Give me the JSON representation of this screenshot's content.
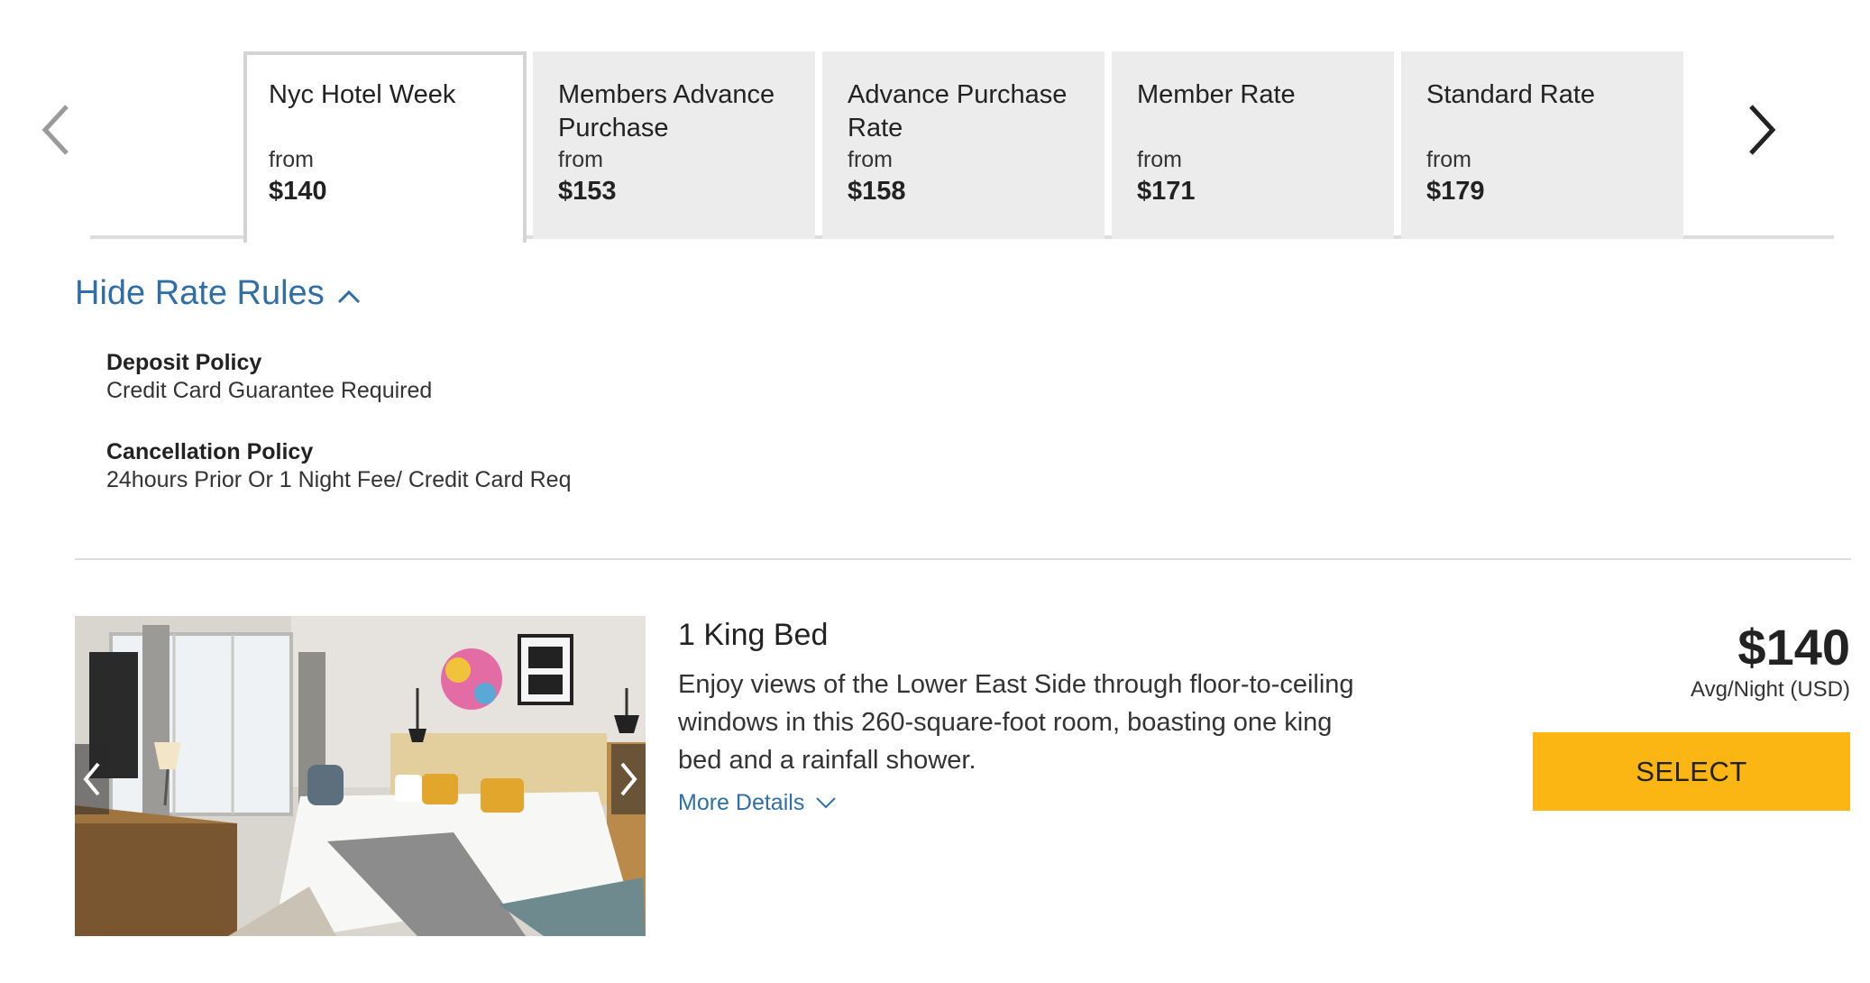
{
  "tabs": [
    {
      "title": "Nyc Hotel Week",
      "from": "from",
      "price": "$140",
      "active": true
    },
    {
      "title": "Members Advance Purchase",
      "from": "from",
      "price": "$153"
    },
    {
      "title": "Advance Purchase Rate",
      "from": "from",
      "price": "$158"
    },
    {
      "title": "Member Rate",
      "from": "from",
      "price": "$171"
    },
    {
      "title": "Standard Rate",
      "from": "from",
      "price": "$179"
    }
  ],
  "nav": {
    "prev_icon": "chevron-left-icon",
    "next_icon": "chevron-right-icon"
  },
  "rules": {
    "toggle_label": "Hide Rate Rules",
    "toggle_icon": "chevron-up-icon",
    "deposit": {
      "title": "Deposit Policy",
      "value": "Credit Card Guarantee Required"
    },
    "cancellation": {
      "title": "Cancellation Policy",
      "value": "24hours Prior Or 1 Night Fee/ Credit Card Req"
    }
  },
  "room": {
    "name": "1 King Bed",
    "description": "Enjoy views of the Lower East Side through floor-to-ceiling windows in this 260-square-foot room, boasting one king bed and a rainfall shower.",
    "more_details": "More Details",
    "price": "$140",
    "price_unit": "Avg/Night (USD)",
    "select_label": "SELECT"
  },
  "colors": {
    "link": "#2f6ea6",
    "select_button": "#fcb614",
    "tab_bg": "#ececec"
  }
}
